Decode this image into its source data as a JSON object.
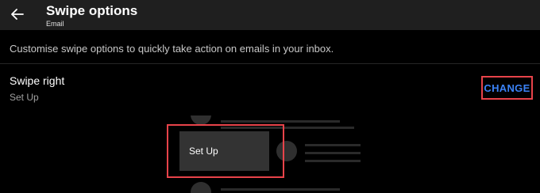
{
  "header": {
    "title": "Swipe options",
    "subtitle": "Email"
  },
  "description": "Customise swipe options to quickly take action on emails in your inbox.",
  "swipe_right": {
    "label": "Swipe right",
    "value": "Set Up",
    "change_label": "CHANGE"
  },
  "preview": {
    "action_label": "Set Up"
  },
  "colors": {
    "background": "#000000",
    "app_bar": "#1f1f1f",
    "accent": "#3b82f6",
    "highlight": "#e8434a"
  },
  "icons": {
    "back": "arrow-left-icon"
  }
}
